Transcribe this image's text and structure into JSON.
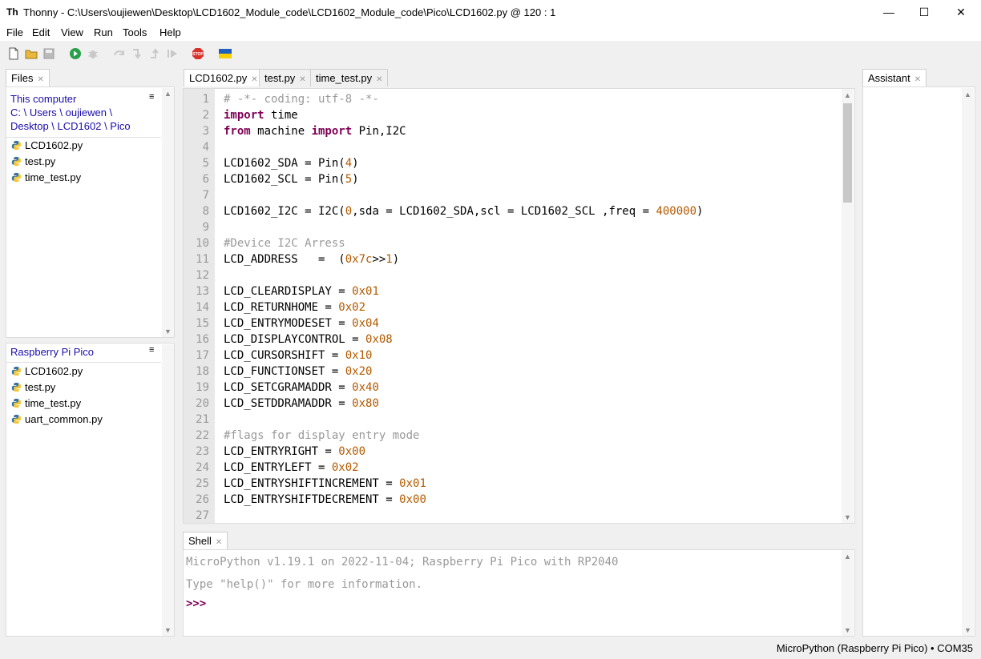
{
  "window": {
    "app_icon": "Th",
    "title": "Thonny  -  C:\\Users\\oujiewen\\Desktop\\LCD1602_Module_code\\LCD1602_Module_code\\Pico\\LCD1602.py  @  120 : 1",
    "minimize": "—",
    "maximize": "☐",
    "close": "✕"
  },
  "menu": [
    "File",
    "Edit",
    "View",
    "Run",
    "Tools",
    "Help"
  ],
  "toolbar": {
    "icons": [
      "new-file-icon",
      "open-folder-icon",
      "save-icon",
      "run-icon",
      "debug-icon",
      "step-over-icon",
      "step-into-icon",
      "step-out-icon",
      "resume-icon",
      "stop-icon",
      "ukraine-flag-icon"
    ],
    "stop_label": "STOP"
  },
  "files_panel": {
    "tab": "Files",
    "computer_title": "This computer",
    "path_line1": "C: \\ Users \\ oujiewen \\",
    "path_line2": "Desktop \\ LCD1602 \\ Pico",
    "computer_files": [
      "LCD1602.py",
      "test.py",
      "time_test.py"
    ],
    "pico_title": "Raspberry Pi Pico",
    "pico_files": [
      "LCD1602.py",
      "test.py",
      "time_test.py",
      "uart_common.py"
    ],
    "menu_glyph": "≡"
  },
  "editor": {
    "tabs": [
      "LCD1602.py",
      "test.py",
      "time_test.py"
    ],
    "active_tab": 0,
    "line_numbers": [
      "1",
      "2",
      "3",
      "4",
      "5",
      "6",
      "7",
      "8",
      "9",
      "10",
      "11",
      "12",
      "13",
      "14",
      "15",
      "16",
      "17",
      "18",
      "19",
      "20",
      "21",
      "22",
      "23",
      "24",
      "25",
      "26",
      "27"
    ],
    "lines": [
      [
        {
          "t": "# -*- coding: utf-8 -*-",
          "c": "cmt"
        }
      ],
      [
        {
          "t": "import",
          "c": "kw"
        },
        {
          "t": " time"
        }
      ],
      [
        {
          "t": "from",
          "c": "kw"
        },
        {
          "t": " machine "
        },
        {
          "t": "import",
          "c": "kw"
        },
        {
          "t": " Pin,I2C"
        }
      ],
      [],
      [
        {
          "t": "LCD1602_SDA = Pin("
        },
        {
          "t": "4",
          "c": "num"
        },
        {
          "t": ")"
        }
      ],
      [
        {
          "t": "LCD1602_SCL = Pin("
        },
        {
          "t": "5",
          "c": "num"
        },
        {
          "t": ")"
        }
      ],
      [],
      [
        {
          "t": "LCD1602_I2C = I2C("
        },
        {
          "t": "0",
          "c": "num"
        },
        {
          "t": ",sda = LCD1602_SDA,scl = LCD1602_SCL ,freq = "
        },
        {
          "t": "400000",
          "c": "num"
        },
        {
          "t": ")"
        }
      ],
      [],
      [
        {
          "t": "#Device I2C Arress",
          "c": "cmt"
        }
      ],
      [
        {
          "t": "LCD_ADDRESS   =  ("
        },
        {
          "t": "0x7c",
          "c": "num"
        },
        {
          "t": ">>"
        },
        {
          "t": "1",
          "c": "num"
        },
        {
          "t": ")"
        }
      ],
      [],
      [
        {
          "t": "LCD_CLEARDISPLAY = "
        },
        {
          "t": "0x01",
          "c": "num"
        }
      ],
      [
        {
          "t": "LCD_RETURNHOME = "
        },
        {
          "t": "0x02",
          "c": "num"
        }
      ],
      [
        {
          "t": "LCD_ENTRYMODESET = "
        },
        {
          "t": "0x04",
          "c": "num"
        }
      ],
      [
        {
          "t": "LCD_DISPLAYCONTROL = "
        },
        {
          "t": "0x08",
          "c": "num"
        }
      ],
      [
        {
          "t": "LCD_CURSORSHIFT = "
        },
        {
          "t": "0x10",
          "c": "num"
        }
      ],
      [
        {
          "t": "LCD_FUNCTIONSET = "
        },
        {
          "t": "0x20",
          "c": "num"
        }
      ],
      [
        {
          "t": "LCD_SETCGRAMADDR = "
        },
        {
          "t": "0x40",
          "c": "num"
        }
      ],
      [
        {
          "t": "LCD_SETDDRAMADDR = "
        },
        {
          "t": "0x80",
          "c": "num"
        }
      ],
      [],
      [
        {
          "t": "#flags for display entry mode",
          "c": "cmt"
        }
      ],
      [
        {
          "t": "LCD_ENTRYRIGHT = "
        },
        {
          "t": "0x00",
          "c": "num"
        }
      ],
      [
        {
          "t": "LCD_ENTRYLEFT = "
        },
        {
          "t": "0x02",
          "c": "num"
        }
      ],
      [
        {
          "t": "LCD_ENTRYSHIFTINCREMENT = "
        },
        {
          "t": "0x01",
          "c": "num"
        }
      ],
      [
        {
          "t": "LCD_ENTRYSHIFTDECREMENT = "
        },
        {
          "t": "0x00",
          "c": "num"
        }
      ],
      []
    ]
  },
  "shell": {
    "tab": "Shell",
    "banner": "MicroPython v1.19.1 on 2022-11-04; Raspberry Pi Pico with RP2040",
    "help_line": "Type \"help()\" for more information.",
    "prompt": ">>>"
  },
  "assistant": {
    "tab": "Assistant"
  },
  "status": {
    "interpreter": "MicroPython (Raspberry Pi Pico)  •  COM35"
  },
  "colors": {
    "keyword": "#7f0055",
    "number": "#b35a00",
    "comment": "#999999",
    "link": "#1a0dab",
    "prompt": "#7f0055"
  }
}
